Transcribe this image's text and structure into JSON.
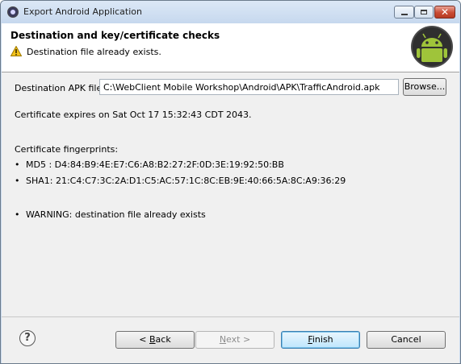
{
  "window": {
    "title": "Export Android Application"
  },
  "banner": {
    "title": "Destination and key/certificate checks",
    "message": "Destination file already exists."
  },
  "form": {
    "destination_label": "Destination APK file:",
    "destination_value": "C:\\WebClient Mobile Workshop\\Android\\APK\\TrafficAndroid.apk",
    "browse_label": "Browse..."
  },
  "certificate": {
    "expires": "Certificate expires on Sat Oct 17 15:32:43 CDT 2043.",
    "fingerprints_heading": "Certificate fingerprints:",
    "md5": "MD5 : D4:84:B9:4E:E7:C6:A8:B2:27:2F:0D:3E:19:92:50:BB",
    "sha1": "SHA1: 21:C4:C7:3C:2A:D1:C5:AC:57:1C:8C:EB:9E:40:66:5A:8C:A9:36:29",
    "warning": "WARNING: destination file already exists"
  },
  "buttons": {
    "back_mnemonic": "B",
    "back_rest": "ack",
    "back_prefix": "< ",
    "next_mnemonic": "N",
    "next_rest": "ext >",
    "finish_mnemonic": "F",
    "finish_rest": "inish",
    "cancel": "Cancel",
    "help": "?"
  },
  "icons": {
    "app": "eclipse-icon",
    "warning": "warning-icon",
    "banner_logo": "android-logo",
    "help": "help-icon"
  },
  "colors": {
    "android_green": "#9fc43a",
    "warning_yellow": "#f2c21b",
    "finish_border": "#3c7fb1"
  }
}
